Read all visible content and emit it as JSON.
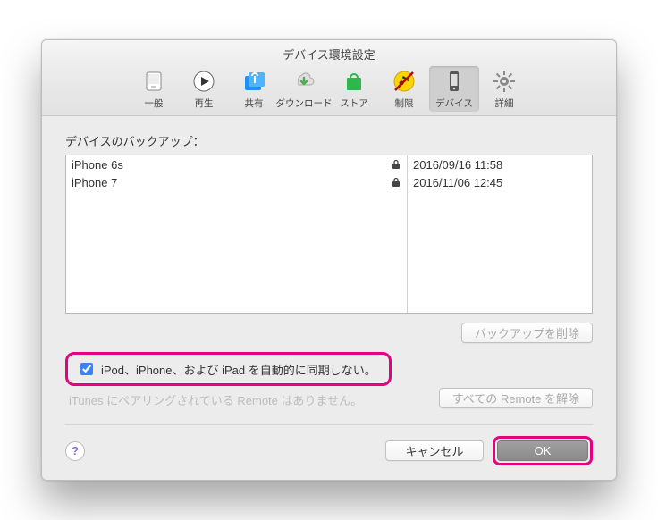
{
  "window_title": "デバイス環境設定",
  "toolbar": [
    {
      "label": "一般"
    },
    {
      "label": "再生"
    },
    {
      "label": "共有"
    },
    {
      "label": "ダウンロード"
    },
    {
      "label": "ストア"
    },
    {
      "label": "制限"
    },
    {
      "label": "デバイス"
    },
    {
      "label": "詳細"
    }
  ],
  "backups_label": "デバイスのバックアップ：",
  "backups": [
    {
      "name": "iPhone 6s",
      "date": "2016/09/16 11:58"
    },
    {
      "name": "iPhone 7",
      "date": "2016/11/06 12:45"
    }
  ],
  "delete_backup_label": "バックアップを削除",
  "sync_checkbox_label": "iPod、iPhone、および iPad を自動的に同期しない。",
  "remote_pair_text": "iTunes にペアリングされている Remote はありません。",
  "unpair_remotes_label": "すべての Remote を解除",
  "help_label": "?",
  "cancel_label": "キャンセル",
  "ok_label": "OK"
}
